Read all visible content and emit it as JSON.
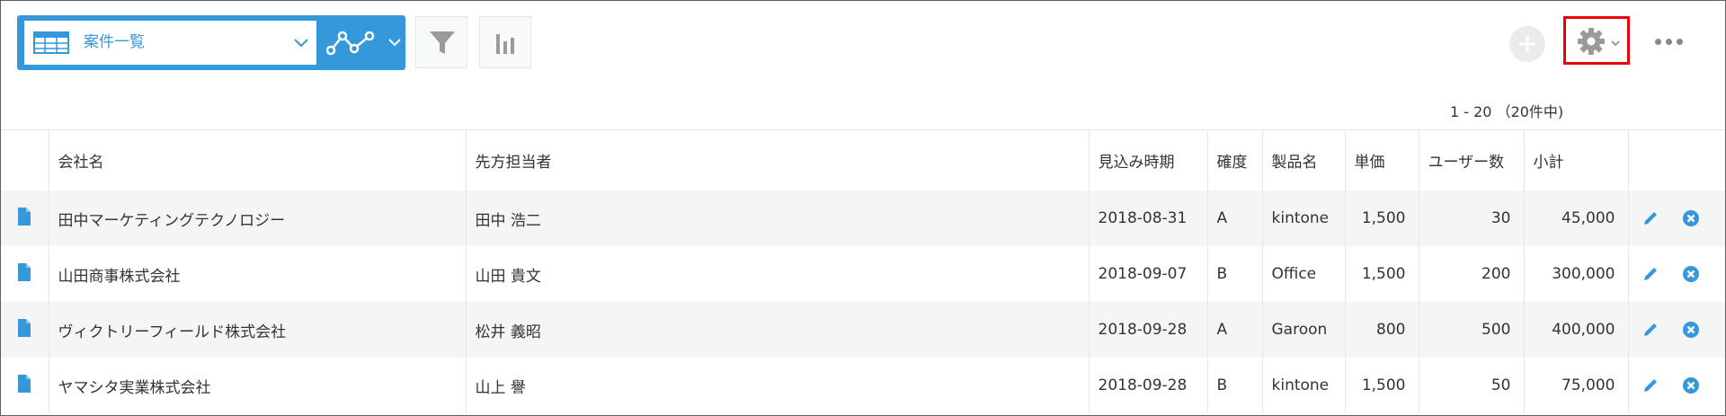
{
  "toolbar": {
    "view_selector": {
      "selected": "案件一覧",
      "icon": "table-icon"
    },
    "graph_button": {
      "icon": "line-graph-icon"
    },
    "filter_button": {
      "icon": "filter-icon"
    },
    "chart_button": {
      "icon": "bar-chart-icon"
    },
    "add_button": {
      "icon": "plus-icon"
    },
    "settings_button": {
      "icon": "gear-icon"
    },
    "more_button": {
      "icon": "more-icon"
    }
  },
  "pagination": {
    "text": "1 - 20 （20件中)"
  },
  "table": {
    "columns": [
      "会社名",
      "先方担当者",
      "見込み時期",
      "確度",
      "製品名",
      "単価",
      "ユーザー数",
      "小計"
    ],
    "rows": [
      {
        "company": "田中マーケティングテクノロジー",
        "contact": "田中 浩二",
        "date": "2018-08-31",
        "confidence": "A",
        "product": "kintone",
        "unit_price": "1,500",
        "users": "30",
        "subtotal": "45,000"
      },
      {
        "company": "山田商事株式会社",
        "contact": "山田 貴文",
        "date": "2018-09-07",
        "confidence": "B",
        "product": "Office",
        "unit_price": "1,500",
        "users": "200",
        "subtotal": "300,000"
      },
      {
        "company": "ヴィクトリーフィールド株式会社",
        "contact": "松井 義昭",
        "date": "2018-09-28",
        "confidence": "A",
        "product": "Garoon",
        "unit_price": "800",
        "users": "500",
        "subtotal": "400,000"
      },
      {
        "company": "ヤマシタ実業株式会社",
        "contact": "山上 譽",
        "date": "2018-09-28",
        "confidence": "B",
        "product": "kintone",
        "unit_price": "1,500",
        "users": "50",
        "subtotal": "75,000"
      }
    ]
  },
  "colors": {
    "accent": "#3498db",
    "highlight": "#e8000b",
    "row_alt": "#f5f5f5",
    "border": "#e3e7e8"
  }
}
